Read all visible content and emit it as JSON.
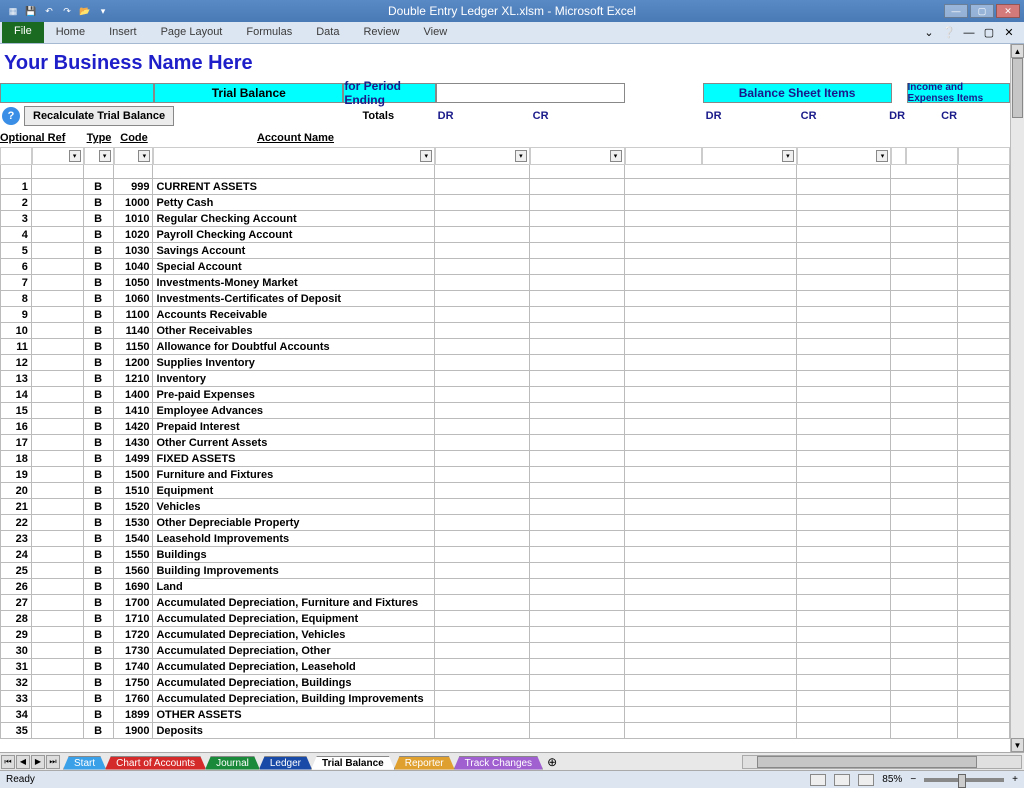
{
  "app_title": "Double Entry Ledger XL.xlsm  -  Microsoft Excel",
  "ribbon": {
    "file": "File",
    "tabs": [
      "Home",
      "Insert",
      "Page Layout",
      "Formulas",
      "Data",
      "Review",
      "View"
    ]
  },
  "business_name": "Your Business Name Here",
  "headers": {
    "trial_balance": "Trial Balance",
    "period_ending": "for Period Ending",
    "balance_sheet": "Balance Sheet Items",
    "income_expenses": "Income and Expenses Items",
    "totals": "Totals",
    "dr": "DR",
    "cr": "CR",
    "optional_ref": "Optional Ref",
    "type": "Type",
    "code": "Code",
    "account_name": "Account Name"
  },
  "recalc_btn": "Recalculate Trial Balance",
  "rows": [
    {
      "n": 1,
      "type": "B",
      "code": "999",
      "name": "CURRENT ASSETS"
    },
    {
      "n": 2,
      "type": "B",
      "code": "1000",
      "name": "Petty Cash"
    },
    {
      "n": 3,
      "type": "B",
      "code": "1010",
      "name": "Regular Checking Account"
    },
    {
      "n": 4,
      "type": "B",
      "code": "1020",
      "name": "Payroll Checking Account"
    },
    {
      "n": 5,
      "type": "B",
      "code": "1030",
      "name": "Savings Account"
    },
    {
      "n": 6,
      "type": "B",
      "code": "1040",
      "name": "Special Account"
    },
    {
      "n": 7,
      "type": "B",
      "code": "1050",
      "name": "Investments-Money Market"
    },
    {
      "n": 8,
      "type": "B",
      "code": "1060",
      "name": "Investments-Certificates of Deposit"
    },
    {
      "n": 9,
      "type": "B",
      "code": "1100",
      "name": "Accounts Receivable"
    },
    {
      "n": 10,
      "type": "B",
      "code": "1140",
      "name": "Other Receivables"
    },
    {
      "n": 11,
      "type": "B",
      "code": "1150",
      "name": "Allowance for Doubtful Accounts"
    },
    {
      "n": 12,
      "type": "B",
      "code": "1200",
      "name": "Supplies Inventory"
    },
    {
      "n": 13,
      "type": "B",
      "code": "1210",
      "name": "Inventory"
    },
    {
      "n": 14,
      "type": "B",
      "code": "1400",
      "name": "Pre-paid Expenses"
    },
    {
      "n": 15,
      "type": "B",
      "code": "1410",
      "name": "Employee Advances"
    },
    {
      "n": 16,
      "type": "B",
      "code": "1420",
      "name": "Prepaid Interest"
    },
    {
      "n": 17,
      "type": "B",
      "code": "1430",
      "name": "Other Current Assets"
    },
    {
      "n": 18,
      "type": "B",
      "code": "1499",
      "name": "FIXED ASSETS"
    },
    {
      "n": 19,
      "type": "B",
      "code": "1500",
      "name": "Furniture and Fixtures"
    },
    {
      "n": 20,
      "type": "B",
      "code": "1510",
      "name": "Equipment"
    },
    {
      "n": 21,
      "type": "B",
      "code": "1520",
      "name": "Vehicles"
    },
    {
      "n": 22,
      "type": "B",
      "code": "1530",
      "name": "Other Depreciable Property"
    },
    {
      "n": 23,
      "type": "B",
      "code": "1540",
      "name": "Leasehold Improvements"
    },
    {
      "n": 24,
      "type": "B",
      "code": "1550",
      "name": "Buildings"
    },
    {
      "n": 25,
      "type": "B",
      "code": "1560",
      "name": "Building Improvements"
    },
    {
      "n": 26,
      "type": "B",
      "code": "1690",
      "name": "Land"
    },
    {
      "n": 27,
      "type": "B",
      "code": "1700",
      "name": "Accumulated Depreciation, Furniture and Fixtures"
    },
    {
      "n": 28,
      "type": "B",
      "code": "1710",
      "name": "Accumulated Depreciation, Equipment"
    },
    {
      "n": 29,
      "type": "B",
      "code": "1720",
      "name": "Accumulated Depreciation, Vehicles"
    },
    {
      "n": 30,
      "type": "B",
      "code": "1730",
      "name": "Accumulated Depreciation, Other"
    },
    {
      "n": 31,
      "type": "B",
      "code": "1740",
      "name": "Accumulated Depreciation, Leasehold"
    },
    {
      "n": 32,
      "type": "B",
      "code": "1750",
      "name": "Accumulated Depreciation, Buildings"
    },
    {
      "n": 33,
      "type": "B",
      "code": "1760",
      "name": "Accumulated Depreciation, Building Improvements"
    },
    {
      "n": 34,
      "type": "B",
      "code": "1899",
      "name": "OTHER ASSETS"
    },
    {
      "n": 35,
      "type": "B",
      "code": "1900",
      "name": "Deposits"
    }
  ],
  "sheet_tabs": [
    {
      "label": "Start",
      "color": "#3aa0e8"
    },
    {
      "label": "Chart of Accounts",
      "color": "#d42a2a"
    },
    {
      "label": "Journal",
      "color": "#1a8a3a"
    },
    {
      "label": "Ledger",
      "color": "#1a4aa8"
    },
    {
      "label": "Trial Balance",
      "color": "#ffffff",
      "active": true
    },
    {
      "label": "Reporter",
      "color": "#e0a030"
    },
    {
      "label": "Track Changes",
      "color": "#a060d0"
    }
  ],
  "status": {
    "ready": "Ready",
    "zoom": "85%"
  }
}
